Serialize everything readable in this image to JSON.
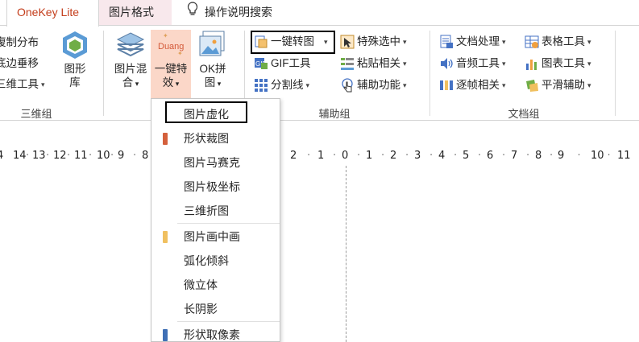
{
  "tabs": {
    "onekey": "OneKey Lite",
    "picture_format": "图片格式",
    "search": "操作说明搜索"
  },
  "ribbon": {
    "group_3d": {
      "items": [
        "復制分布",
        "底边垂移",
        "三维工具"
      ],
      "big_button": "图形库",
      "big_button_line1": "图形",
      "big_button_line2": "库",
      "label": "三维组"
    },
    "picture_mix": {
      "line1": "图片混",
      "line2": "合"
    },
    "one_click_effect": {
      "line1": "一键特",
      "line2": "效",
      "icon_text": "Duang"
    },
    "ok_stitch": {
      "line1": "OK拼",
      "line2": "图"
    },
    "aux_group": {
      "col1": [
        "一键转图",
        "GIF工具",
        "分割线"
      ],
      "col2": [
        "特殊选中",
        "粘贴相关",
        "辅助功能"
      ],
      "label": "辅助组"
    },
    "doc_group": {
      "col1": [
        "文档处理",
        "音频工具",
        "逐帧相关"
      ],
      "col2": [
        "表格工具",
        "图表工具",
        "平滑辅助"
      ],
      "label": "文档组"
    }
  },
  "ruler": {
    "ticks": [
      "14",
      "13",
      "12",
      "11",
      "10",
      "9",
      "8",
      "2",
      "1",
      "0",
      "1",
      "2",
      "3",
      "4",
      "5",
      "6",
      "7",
      "8",
      "9",
      "10",
      "11"
    ]
  },
  "menu": {
    "items": [
      "图片虚化",
      "形状裁图",
      "图片马赛克",
      "图片极坐标",
      "三维折图",
      "图片画中画",
      "弧化倾斜",
      "微立体",
      "长阴影",
      "形状取像素"
    ]
  },
  "colors": {
    "accent": "#c43e1c",
    "tab_pink": "#f8e8ec",
    "mark_red": "#d4603c",
    "mark_yellow": "#f0c060",
    "mark_blue": "#3f6fb5"
  }
}
